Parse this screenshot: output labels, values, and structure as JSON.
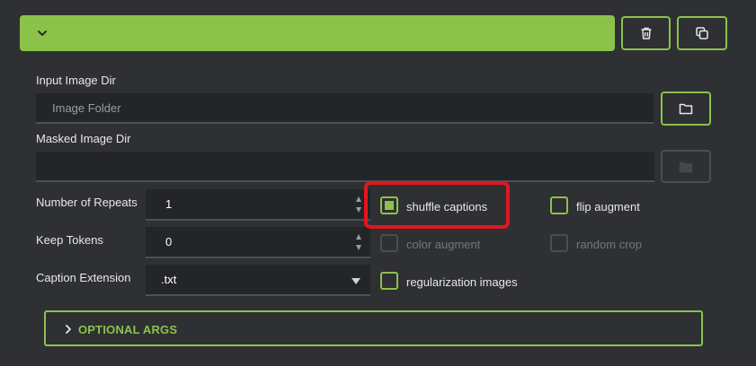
{
  "header": {
    "expand_icon": "chevron-down-icon",
    "delete_icon": "trash-icon",
    "copy_icon": "copy-icon"
  },
  "input_image_dir": {
    "label": "Input Image Dir",
    "placeholder": "Image Folder",
    "value": "",
    "browse_icon": "folder-icon"
  },
  "masked_image_dir": {
    "label": "Masked Image Dir",
    "placeholder": "",
    "value": "",
    "browse_icon": "folder-icon"
  },
  "number_of_repeats": {
    "label": "Number of Repeats",
    "value": "1"
  },
  "keep_tokens": {
    "label": "Keep Tokens",
    "value": "0"
  },
  "caption_extension": {
    "label": "Caption Extension",
    "value": ".txt"
  },
  "checkboxes": {
    "shuffle_captions": {
      "label": "shuffle captions",
      "checked": true,
      "enabled": true
    },
    "flip_augment": {
      "label": "flip augment",
      "checked": false,
      "enabled": true
    },
    "color_augment": {
      "label": "color augment",
      "checked": false,
      "enabled": false
    },
    "random_crop": {
      "label": "random crop",
      "checked": false,
      "enabled": false
    },
    "regularization_images": {
      "label": "regularization images",
      "checked": false,
      "enabled": true
    }
  },
  "optional_args": {
    "label": "OPTIONAL ARGS",
    "icon": "chevron-right-icon"
  },
  "colors": {
    "accent": "#8bc34a",
    "background": "#2e3033",
    "input_background": "#232528",
    "highlight": "#e3151f"
  }
}
